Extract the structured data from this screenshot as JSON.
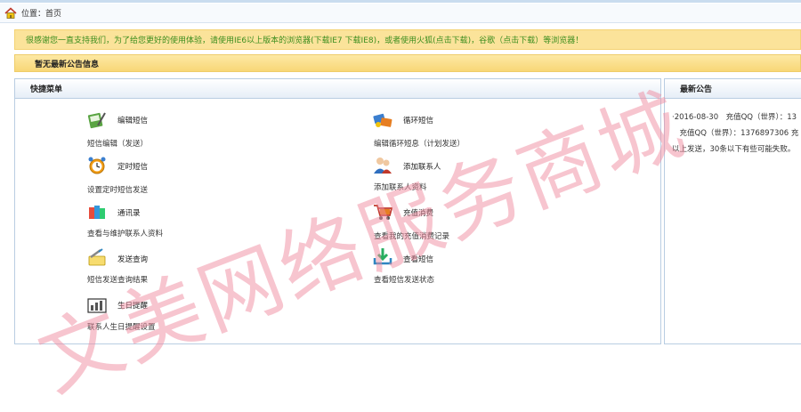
{
  "breadcrumb": {
    "text": "位置：首页"
  },
  "notice": {
    "text_before": "很感谢您一直支持我们，为了给您更好的使用体验，请使用IE6以上版本的浏览器(",
    "link_ie7": "下载IE7",
    "sep": " ",
    "link_ie8": "下载IE8",
    "text_mid": ")，或者使用",
    "link_firefox": "火狐(点击下载)",
    "text_mid2": "，谷歌（",
    "link_chrome": "点击下载",
    "text_end": "）等浏览器！"
  },
  "announcement_bar": {
    "text": "暂无最新公告信息"
  },
  "quick_menu": {
    "title": "快捷菜单",
    "items": [
      {
        "title": "编辑短信",
        "desc": "短信编辑（发送）",
        "icon": "edit-sms-icon"
      },
      {
        "title": "循环短信",
        "desc": "编辑循环短息（计划发送）",
        "icon": "loop-sms-icon"
      },
      {
        "title": "定时短信",
        "desc": "设置定时短信发送",
        "icon": "alarm-clock-icon"
      },
      {
        "title": "添加联系人",
        "desc": "添加联系人资料",
        "icon": "add-contact-icon"
      },
      {
        "title": "通讯录",
        "desc": "查看与维护联系人资料",
        "icon": "address-book-icon"
      },
      {
        "title": "充值消费",
        "desc": "查看我的充值消费记录",
        "icon": "shopping-cart-icon"
      },
      {
        "title": "发送查询",
        "desc": "短信发送查询结果",
        "icon": "send-query-icon"
      },
      {
        "title": "查看短信",
        "desc": "查看短信发送状态",
        "icon": "download-icon"
      },
      {
        "title": "生日提醒",
        "desc": "联系人生日提醒设置",
        "icon": "birthday-chart-icon"
      }
    ]
  },
  "latest": {
    "title": "最新公告",
    "line1": "·2016-08-30　充值QQ（世界）：13",
    "line2": "　充值QQ（世界）：1376897306 充",
    "line3": "以上发送，30条以下有些可能失败。"
  },
  "watermark": {
    "text": "文美网络服务商城",
    "color": "#f08ca0"
  }
}
